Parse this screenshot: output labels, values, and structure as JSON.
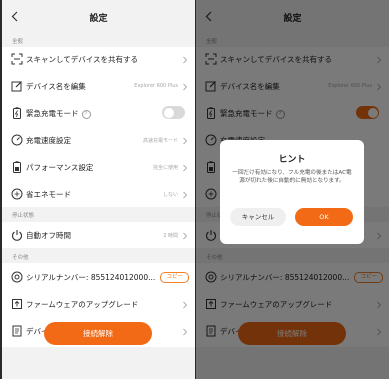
{
  "header": {
    "title": "設定"
  },
  "sections": {
    "general": "全般",
    "stop": "停止状態",
    "other": "その他"
  },
  "rows": {
    "scan_share": {
      "label": "スキャンしてデバイスを共有する"
    },
    "rename": {
      "label": "デバイス名を編集",
      "value": "Explorer 600 Plus"
    },
    "emergency": {
      "label": "緊急充電モード",
      "help": "?"
    },
    "charge_speed": {
      "label": "充電速度設定",
      "value": "高速充電モード"
    },
    "performance": {
      "label": "パフォーマンス設定",
      "value": "完全に使用"
    },
    "eco": {
      "label": "省エネモード",
      "value": "しない"
    },
    "auto_off": {
      "label": "自動オフ時間",
      "value": "2 時間"
    },
    "serial": {
      "label": "シリアルナンバー: 855124012000...",
      "copy": "コピー"
    },
    "firmware": {
      "label": "ファームウェアのアップグレード"
    },
    "device_spec": {
      "label": "デバイス仕様"
    }
  },
  "disconnect_label": "接続解除",
  "dialog": {
    "title": "ヒント",
    "body": "一回だけ有効になり、フル充電の後またはAC電源が切れた後に自動的に無効となります。",
    "cancel": "キャンセル",
    "ok": "OK"
  },
  "toggles": {
    "left_emergency_on": false,
    "right_emergency_on": true
  },
  "colors": {
    "accent": "#f26a16",
    "background": "#f2f2f2",
    "card": "#ffffff",
    "dim_overlay": "rgba(0,0,0,0.52)"
  },
  "icons": {
    "back": "chevron-left-icon",
    "scan": "scan-icon",
    "edit": "edit-icon",
    "emergency": "battery-icon",
    "charge_speed": "speed-gauge-icon",
    "performance": "battery-icon",
    "eco": "eco-icon",
    "power": "power-icon",
    "serial": "serial-icon",
    "firmware": "firmware-icon",
    "spec": "document-icon",
    "chevron": "chevron-right-icon"
  }
}
